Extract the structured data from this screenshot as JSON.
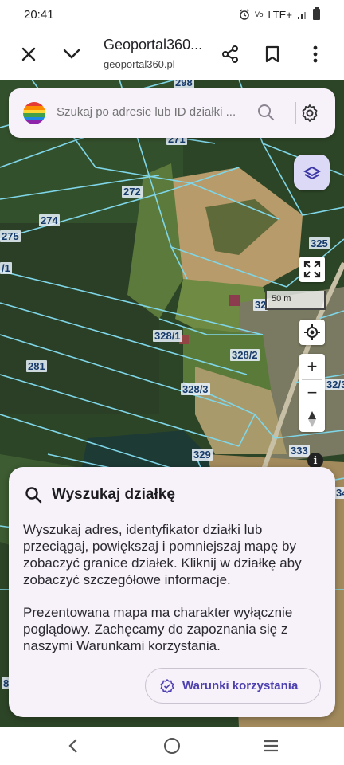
{
  "status_bar": {
    "time": "20:41",
    "network": "LTE+",
    "icons": [
      "alarm-icon",
      "volte-icon",
      "signal-icon",
      "battery-icon"
    ]
  },
  "browser": {
    "title": "Geoportal360...",
    "url": "geoportal360.pl",
    "icons": [
      "close-icon",
      "chevron-down-icon",
      "share-icon",
      "bookmark-icon",
      "more-vert-icon"
    ]
  },
  "search": {
    "placeholder": "Szukaj po adresie lub ID działki ...",
    "icons": [
      "geoportal-logo",
      "search-icon",
      "settings-gear-icon"
    ]
  },
  "map": {
    "parcels": [
      "298",
      "271",
      "272",
      "274",
      "275",
      "/1",
      "325",
      "32",
      "328/1",
      "328/2",
      "281",
      "328/3",
      "329",
      "333",
      "32/3",
      "34",
      "8"
    ],
    "scale_label": "50 m",
    "controls": [
      "layers-icon",
      "fullscreen-icon",
      "my-location-icon",
      "zoom-in-icon",
      "zoom-out-icon",
      "compass-icon",
      "info-icon"
    ],
    "zoom_in_label": "+",
    "zoom_out_label": "−",
    "info_label": "i"
  },
  "card": {
    "title": "Wyszukaj działkę",
    "paragraph1": "Wyszukaj adres, identyfikator działki lub przeciągaj, powiększaj i pomniejszaj mapę by zobaczyć granice działek. Kliknij w działkę aby zobaczyć szczegółowe informacje.",
    "paragraph2": "Prezentowana mapa ma charakter wyłącznie poglądowy. Zachęcamy do zapoznania się z naszymi Warunkami korzystania.",
    "terms_button": "Warunki korzystania"
  },
  "nav_bar": {
    "icons": [
      "back-icon",
      "home-icon",
      "recents-icon"
    ]
  },
  "colors": {
    "accent": "#4c3fb0",
    "card_bg": "#f7f2fa",
    "parcel_line": "#7fd6e8"
  }
}
